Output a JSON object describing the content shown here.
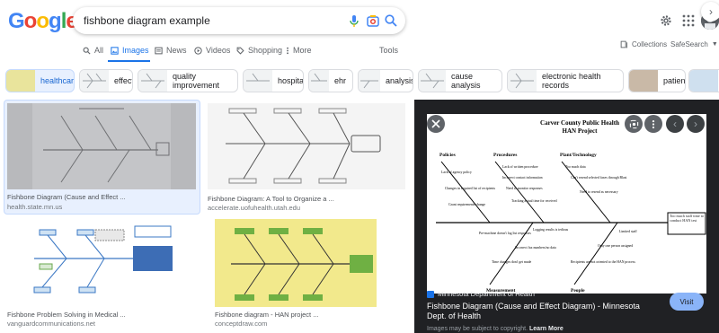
{
  "logo": {
    "letters": [
      "G",
      "o",
      "o",
      "g",
      "l",
      "e"
    ],
    "colors": [
      "#4285f4",
      "#ea4335",
      "#fbbc05",
      "#4285f4",
      "#34a853",
      "#ea4335"
    ]
  },
  "search": {
    "query": "fishbone diagram example"
  },
  "tabs": [
    {
      "label": "All",
      "icon": "search-icon"
    },
    {
      "label": "Images",
      "icon": "image-icon",
      "active": true
    },
    {
      "label": "News",
      "icon": "news-icon"
    },
    {
      "label": "Videos",
      "icon": "play-icon"
    },
    {
      "label": "Shopping",
      "icon": "tag-icon"
    },
    {
      "label": "More",
      "icon": "dots-vertical-icon"
    }
  ],
  "tools_label": "Tools",
  "collections_label": "Collections",
  "safesearch_label": "SafeSearch",
  "chips": [
    "healthcare",
    "effect",
    "quality improvement",
    "hospital",
    "ehr",
    "analysis",
    "cause analysis",
    "electronic health records",
    "patient"
  ],
  "results": [
    {
      "title": "Fishbone Diagram (Cause and Effect ...",
      "source": "health.state.mn.us"
    },
    {
      "title": "Fishbone Diagram: A Tool to Organize a ...",
      "source": "accelerate.uofuhealth.utah.edu"
    },
    {
      "title": "Fishbone Problem Solving in Medical ...",
      "source": "vanguardcommunications.net"
    },
    {
      "title": "Fishbone diagram - HAN project ...",
      "source": "conceptdraw.com"
    }
  ],
  "preview": {
    "diagram": {
      "title_line1": "Carver County Public Health",
      "title_line2": "HAN Project",
      "categories_top": [
        "Policies",
        "Procedures",
        "Plant/Technology"
      ],
      "categories_bottom": [
        "Measurement",
        "People"
      ],
      "effect": "Too much staff time to conduct HAN test",
      "causes": [
        "Lack of agency policy",
        "Changes in required list of recipients",
        "Grant requirements change",
        "Incorrect contact information",
        "Need to monitor responses",
        "Tracking actual time for received",
        "Lack of written procedure",
        "Too much data",
        "Can't resend selected faxes through Blast",
        "Need to resend as necessary",
        "Pre-machine doesn't log list responses",
        "Logging results is tedious",
        "Incorrect fax numbers/no data",
        "Time changes don't get made",
        "Limited staff",
        "Only one person assigned",
        "Recipients are not oriented to the HAN process"
      ]
    },
    "source": "Minnesota Department of Health",
    "title": "Fishbone Diagram (Cause and Effect Diagram) - Minnesota Dept. of Health",
    "note_prefix": "Images may be subject to copyright.",
    "note_link": "Learn More",
    "visit_label": "Visit"
  },
  "brand_colors": {
    "accent": "#1a73e8",
    "chip_selected_bg": "#e8f0fe",
    "panel_bg": "#202124",
    "visit_bg": "#8ab4f8"
  }
}
